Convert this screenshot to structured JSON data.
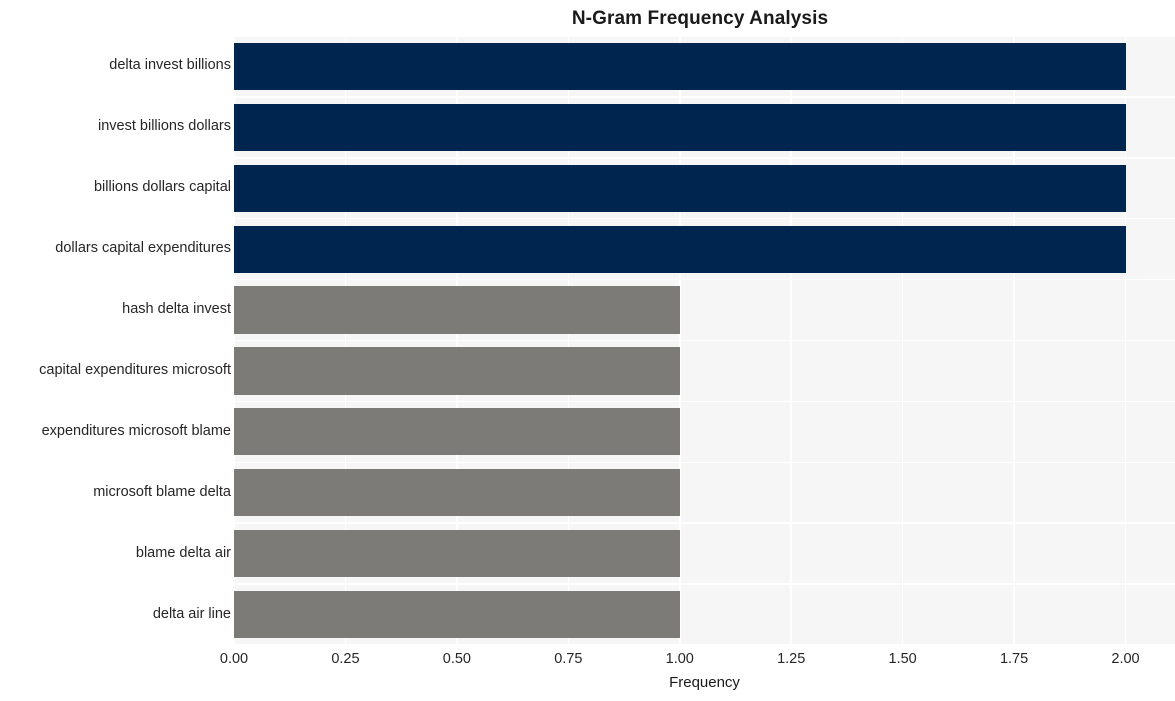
{
  "chart_data": {
    "type": "bar",
    "orientation": "horizontal",
    "title": "N-Gram Frequency Analysis",
    "xlabel": "Frequency",
    "ylabel": "",
    "categories": [
      "delta invest billions",
      "invest billions dollars",
      "billions dollars capital",
      "dollars capital expenditures",
      "hash delta invest",
      "capital expenditures microsoft",
      "expenditures microsoft blame",
      "microsoft blame delta",
      "blame delta air",
      "delta air line"
    ],
    "values": [
      2,
      2,
      2,
      2,
      1,
      1,
      1,
      1,
      1,
      1
    ],
    "bar_colors": [
      "#00254e",
      "#00254e",
      "#00254e",
      "#00254e",
      "#7d7b78",
      "#7d7b78",
      "#7d7b78",
      "#7d7b78",
      "#7d7b78",
      "#7d7b78"
    ],
    "xlim": [
      0,
      2.111
    ],
    "xticks": [
      0,
      0.25,
      0.5,
      0.75,
      1,
      1.25,
      1.5,
      1.75,
      2
    ],
    "xtick_labels": [
      "0.00",
      "0.25",
      "0.50",
      "0.75",
      "1.00",
      "1.25",
      "1.50",
      "1.75",
      "2.00"
    ],
    "grid": true,
    "grid_color": "#ffffff",
    "legend": null,
    "plot_background": "#f6f6f6",
    "figure_background": "#ffffff",
    "accent_color": "#00254e",
    "secondary_color": "#7d7b78"
  }
}
